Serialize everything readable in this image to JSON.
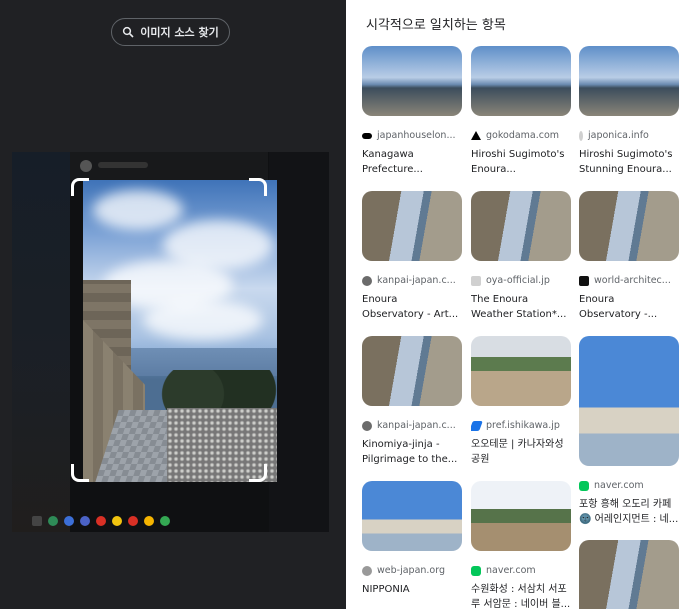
{
  "left_pane": {
    "find_source_button": "이미지 소스 찾기"
  },
  "results": {
    "heading": "시각적으로 일치하는 항목",
    "items": [
      {
        "source": "japanhouselon...",
        "title": "Kanagawa Prefecture...",
        "favicon_color": "#000000"
      },
      {
        "source": "gokodama.com",
        "title": "Hiroshi Sugimoto's Enoura...",
        "favicon_color": "#000000"
      },
      {
        "source": "japonica.info",
        "title": "Hiroshi Sugimoto's Stunning Enoura...",
        "favicon_color": "#cfcfcf"
      },
      {
        "source": "kanpai-japan.c...",
        "title": "Enoura Observatory - Art...",
        "favicon_color": "#6b6b6b"
      },
      {
        "source": "oya-official.jp",
        "title": "The Enoura Weather Station*...",
        "favicon_color": "#d0d0d0"
      },
      {
        "source": "world-architec...",
        "title": "Enoura Observatory -...",
        "favicon_color": "#111111"
      },
      {
        "source": "kanpai-japan.c...",
        "title": "Kinomiya-jinja - Pilgrimage to the...",
        "favicon_color": "#6b6b6b"
      },
      {
        "source": "pref.ishikawa.jp",
        "title": "오오테문 | 카나자와성 공원",
        "favicon_color": "#1a73e8"
      },
      {
        "source": "naver.com",
        "title": "포항 흥해 오도리 카페 🌚 어레인지먼트 : 네...",
        "favicon_color": "#03c75a"
      },
      {
        "source": "web-japan.org",
        "title": "NIPPONIA",
        "favicon_color": "#999999"
      },
      {
        "source": "naver.com",
        "title": "수원화성 : 서삼치 서포루 서암문 : 네이버 블...",
        "favicon_color": "#03c75a"
      }
    ]
  }
}
